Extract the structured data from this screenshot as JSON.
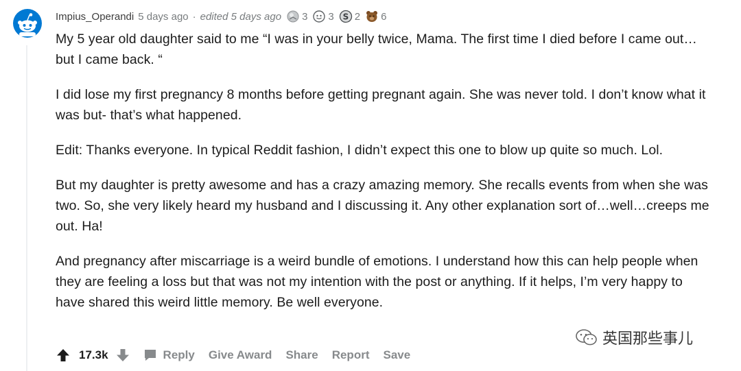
{
  "comment": {
    "author": "Impius_Operandi",
    "time": "5 days ago",
    "separator": "·",
    "edited": "edited 5 days ago",
    "awards": [
      {
        "icon": "silver-award-icon",
        "count": "3"
      },
      {
        "icon": "wholesome-award-icon",
        "count": "3"
      },
      {
        "icon": "s-coin-award-icon",
        "count": "2"
      },
      {
        "icon": "bear-award-icon",
        "count": "6"
      }
    ],
    "paragraphs": [
      "My 5 year old daughter said to me “I was in your belly twice, Mama. The first time I died before I came out…but I came back. “",
      "I did lose my first pregnancy 8 months before getting pregnant again. She was never told. I don’t know what it was but- that’s what happened.",
      "Edit: Thanks everyone. In typical Reddit fashion, I didn’t expect this one to blow up quite so much. Lol.",
      "But my daughter is pretty awesome and has a crazy amazing memory. She recalls events from when she was two. So, she very likely heard my husband and I discussing it. Any other explanation sort of…well…creeps me out. Ha!",
      "And pregnancy after miscarriage is a weird bundle of emotions. I understand how this can help people when they are feeling a loss but that was not my intention with the post or anything. If it helps, I’m very happy to have shared this weird little memory. Be well everyone."
    ]
  },
  "actions": {
    "score": "17.3k",
    "reply": "Reply",
    "give_award": "Give Award",
    "share": "Share",
    "report": "Report",
    "save": "Save"
  },
  "watermark": {
    "text": "英国那些事儿"
  },
  "colors": {
    "meta": "#787c7e",
    "action": "#878a8c",
    "text": "#1c1c1c",
    "avatar_blue": "#0079d3"
  }
}
